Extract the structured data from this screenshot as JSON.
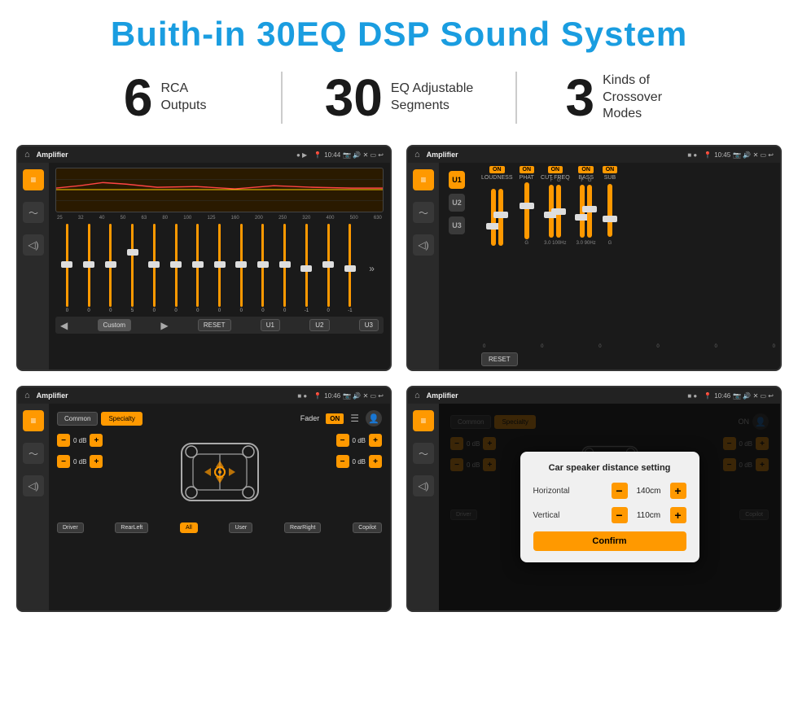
{
  "header": {
    "title": "Buith-in 30EQ DSP Sound System"
  },
  "stats": [
    {
      "number": "6",
      "desc_line1": "RCA",
      "desc_line2": "Outputs"
    },
    {
      "number": "30",
      "desc_line1": "EQ Adjustable",
      "desc_line2": "Segments"
    },
    {
      "number": "3",
      "desc_line1": "Kinds of",
      "desc_line2": "Crossover Modes"
    }
  ],
  "screens": {
    "eq": {
      "app_title": "Amplifier",
      "time": "10:44",
      "eq_labels": [
        "25",
        "32",
        "40",
        "50",
        "63",
        "80",
        "100",
        "125",
        "160",
        "200",
        "250",
        "320",
        "400",
        "500",
        "630"
      ],
      "eq_values": [
        "0",
        "0",
        "0",
        "5",
        "0",
        "0",
        "0",
        "0",
        "0",
        "0",
        "0",
        "-1",
        "0",
        "-1"
      ],
      "preset": "Custom",
      "buttons": [
        "RESET",
        "U1",
        "U2",
        "U3"
      ]
    },
    "crossover": {
      "app_title": "Amplifier",
      "time": "10:45",
      "u_buttons": [
        "U1",
        "U2",
        "U3"
      ],
      "controls": [
        "LOUDNESS",
        "PHAT",
        "CUT FREQ",
        "BASS",
        "SUB"
      ],
      "reset_label": "RESET"
    },
    "fader": {
      "app_title": "Amplifier",
      "time": "10:46",
      "tabs": [
        "Common",
        "Specialty"
      ],
      "fader_label": "Fader",
      "on_label": "ON",
      "locations": [
        "Driver",
        "RearLeft",
        "All",
        "User",
        "RearRight",
        "Copilot"
      ],
      "vol_rows": [
        {
          "label": "0 dB"
        },
        {
          "label": "0 dB"
        },
        {
          "label": "0 dB"
        },
        {
          "label": "0 dB"
        }
      ]
    },
    "distance": {
      "app_title": "Amplifier",
      "time": "10:46",
      "tabs": [
        "Common",
        "Specialty"
      ],
      "modal": {
        "title": "Car speaker distance setting",
        "horizontal_label": "Horizontal",
        "horizontal_value": "140cm",
        "vertical_label": "Vertical",
        "vertical_value": "110cm",
        "confirm_label": "Confirm"
      }
    }
  }
}
